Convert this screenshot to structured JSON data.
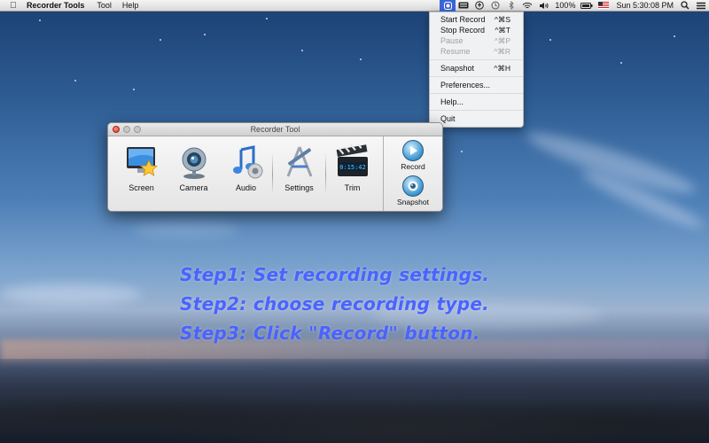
{
  "menubar": {
    "app_name": "Recorder Tools",
    "menus": [
      "Tool",
      "Help"
    ],
    "battery": "100%",
    "clock": "Sun 5:30:08 PM",
    "icons": [
      "apple-icon",
      "recorder-status-icon",
      "keyboard-icon",
      "accessibility-icon",
      "time-machine-icon",
      "bluetooth-icon",
      "wifi-icon",
      "volume-icon",
      "battery-icon",
      "flag-icon",
      "spotlight-icon",
      "notification-list-icon"
    ]
  },
  "dropdown": {
    "items": [
      {
        "label": "Start Record",
        "shortcut": "^⌘S",
        "enabled": true
      },
      {
        "label": "Stop Record",
        "shortcut": "^⌘T",
        "enabled": true
      },
      {
        "label": "Pause",
        "shortcut": "^⌘P",
        "enabled": false
      },
      {
        "label": "Resume",
        "shortcut": "^⌘R",
        "enabled": false
      },
      {
        "label": "Snapshot",
        "shortcut": "^⌘H",
        "enabled": true
      },
      {
        "label": "Preferences...",
        "shortcut": "",
        "enabled": true
      },
      {
        "label": "Help...",
        "shortcut": "",
        "enabled": true
      },
      {
        "label": "Quit",
        "shortcut": "",
        "enabled": true
      }
    ]
  },
  "window": {
    "title": "Recorder Tool",
    "tools": [
      {
        "label": "Screen",
        "icon": "screen-star-icon"
      },
      {
        "label": "Camera",
        "icon": "webcam-icon"
      },
      {
        "label": "Audio",
        "icon": "music-note-icon"
      },
      {
        "label": "Settings",
        "icon": "settings-tools-icon"
      },
      {
        "label": "Trim",
        "icon": "clapperboard-icon"
      }
    ],
    "trim_display": "0:15:42",
    "side_buttons": [
      {
        "label": "Record",
        "icon": "play-icon"
      },
      {
        "label": "Snapshot",
        "icon": "camera-lens-icon"
      }
    ]
  },
  "instructions": [
    "Step1: Set recording settings.",
    "Step2: choose recording type.",
    "Step3: Click \"Record\" button."
  ],
  "colors": {
    "instruction_text": "#4a63ff",
    "menu_highlight": "#3a64d8",
    "close_button": "#d9362b"
  }
}
